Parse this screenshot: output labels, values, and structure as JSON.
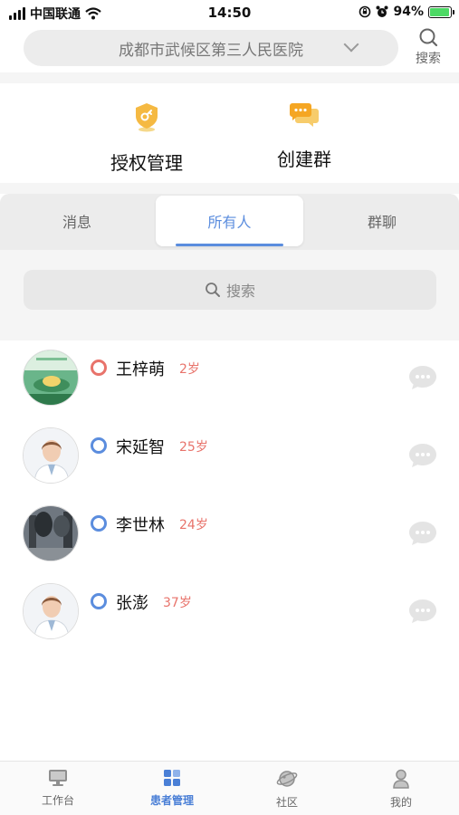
{
  "status_bar": {
    "carrier": "中国联通",
    "time": "14:50",
    "battery": "94%"
  },
  "header": {
    "hospital": "成都市武候区第三人民医院",
    "search_label": "搜索"
  },
  "quick_actions": [
    {
      "label": "授权管理",
      "icon": "shield-key-icon"
    },
    {
      "label": "创建群",
      "icon": "chat-bubbles-icon"
    }
  ],
  "tabs": [
    {
      "label": "消息"
    },
    {
      "label": "所有人"
    },
    {
      "label": "群聊"
    }
  ],
  "active_tab": "所有人",
  "search": {
    "placeholder": "搜索"
  },
  "patients": [
    {
      "name": "王梓萌",
      "age": "2岁",
      "gender": "female"
    },
    {
      "name": "宋延智",
      "age": "25岁",
      "gender": "male"
    },
    {
      "name": "李世林",
      "age": "24岁",
      "gender": "male"
    },
    {
      "name": "张澎",
      "age": "37岁",
      "gender": "male"
    }
  ],
  "bottom_nav": [
    {
      "label": "工作台",
      "icon": "monitor-icon"
    },
    {
      "label": "患者管理",
      "icon": "grid-icon"
    },
    {
      "label": "社区",
      "icon": "planet-icon"
    },
    {
      "label": "我的",
      "icon": "person-icon"
    }
  ],
  "active_nav": "患者管理",
  "colors": {
    "accent": "#5b8dde",
    "female": "#e8736b",
    "male": "#5b8dde",
    "quick_icon": "#f5b942"
  }
}
